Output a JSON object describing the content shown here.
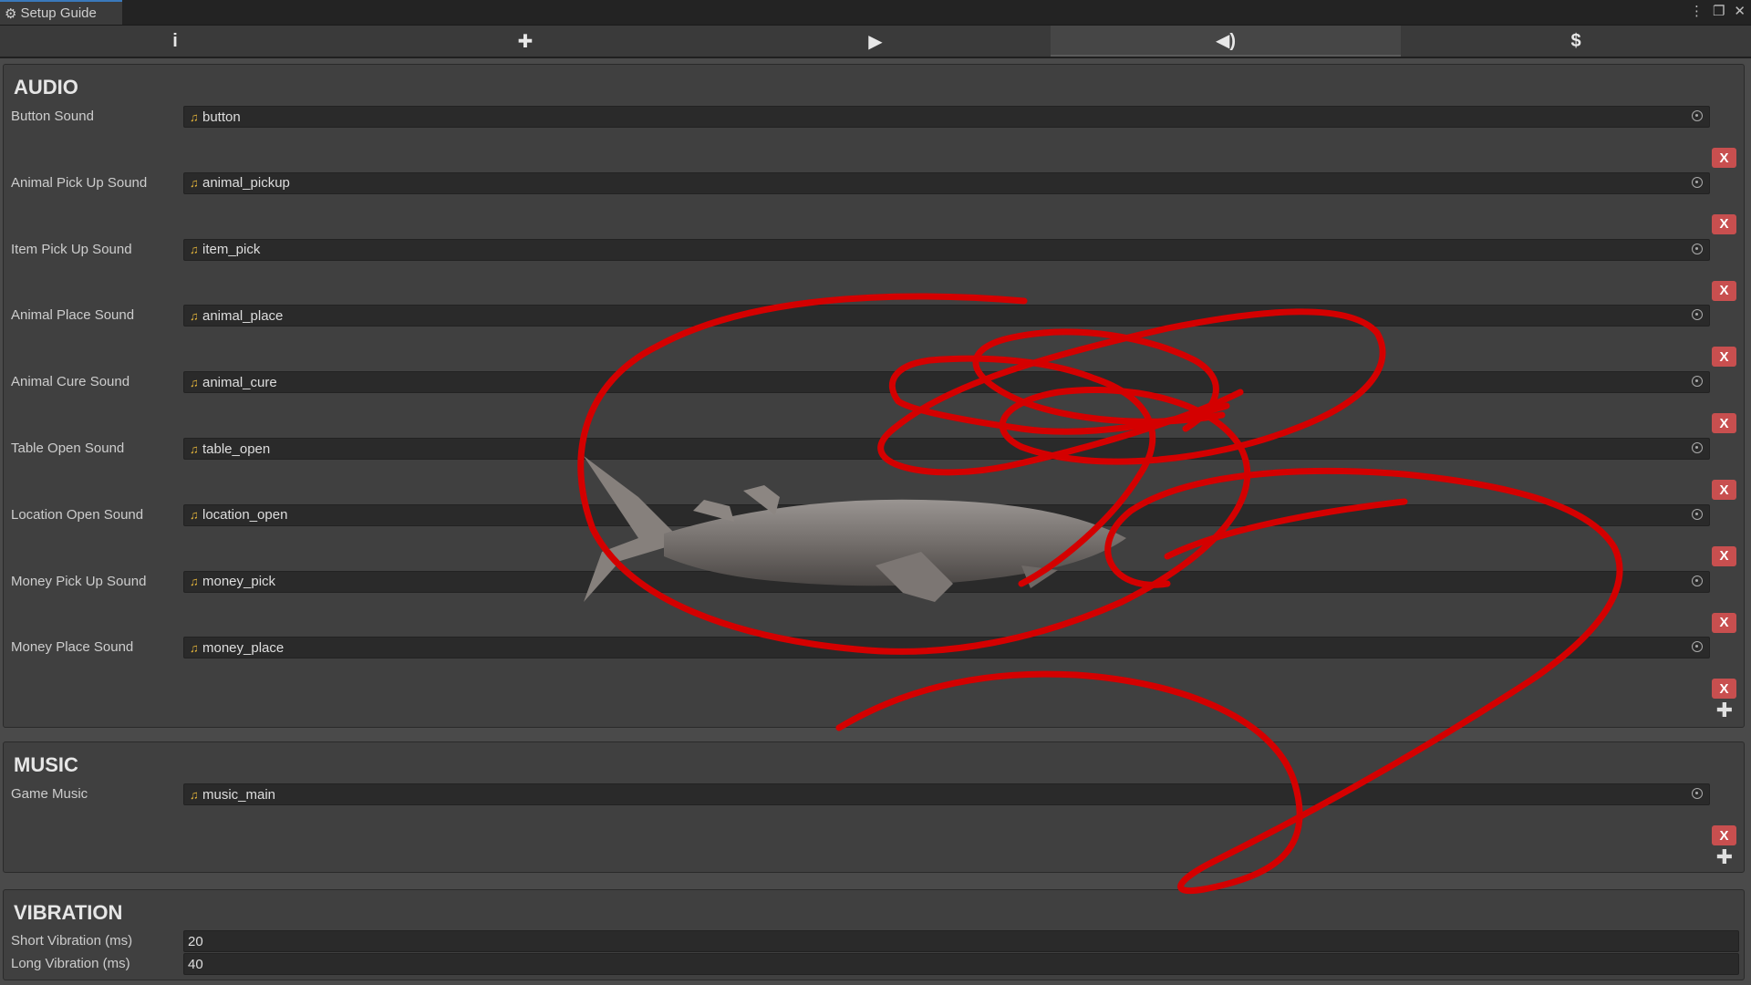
{
  "window": {
    "title": "Setup Guide"
  },
  "tabs": [
    {
      "icon": "info-icon",
      "glyph": "i"
    },
    {
      "icon": "puzzle-icon",
      "glyph": "✚"
    },
    {
      "icon": "screen-icon",
      "glyph": "▶"
    },
    {
      "icon": "speaker-icon",
      "glyph": "◀)"
    },
    {
      "icon": "dollar-icon",
      "glyph": "$"
    }
  ],
  "active_tab": 3,
  "audio": {
    "title": "AUDIO",
    "items": [
      {
        "label": "Button Sound",
        "value": "button"
      },
      {
        "label": "Animal Pick Up Sound",
        "value": "animal_pickup"
      },
      {
        "label": "Item Pick Up Sound",
        "value": "item_pick"
      },
      {
        "label": "Animal Place Sound",
        "value": "animal_place"
      },
      {
        "label": "Animal Cure Sound",
        "value": "animal_cure"
      },
      {
        "label": "Table Open Sound",
        "value": "table_open"
      },
      {
        "label": "Location Open Sound",
        "value": "location_open"
      },
      {
        "label": "Money Pick Up Sound",
        "value": "money_pick"
      },
      {
        "label": "Money Place Sound",
        "value": "money_place"
      }
    ],
    "remove_label": "X"
  },
  "music": {
    "title": "MUSIC",
    "items": [
      {
        "label": "Game Music",
        "value": "music_main"
      }
    ],
    "remove_label": "X"
  },
  "vibration": {
    "title": "VIBRATION",
    "items": [
      {
        "label": "Short Vibration (ms)",
        "value": "20"
      },
      {
        "label": "Long Vibration (ms)",
        "value": "40"
      }
    ]
  },
  "colors": {
    "accent": "#3a79bb",
    "remove": "#c84f4f",
    "scribble": "#d40000",
    "note_icon": "#e2b33a"
  }
}
